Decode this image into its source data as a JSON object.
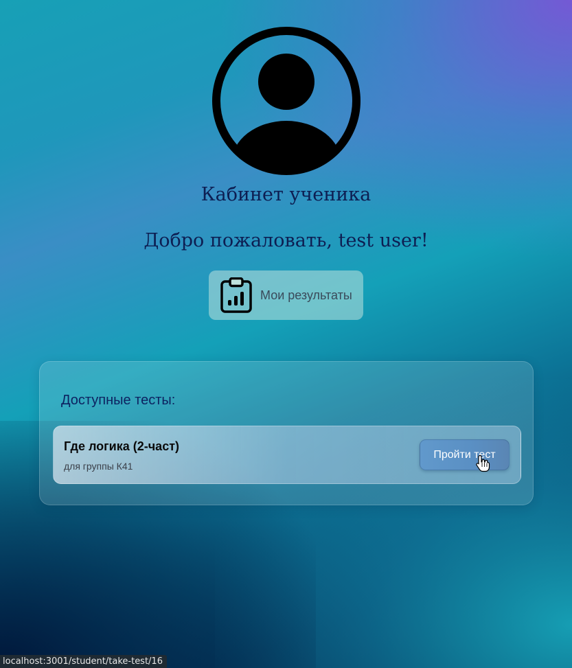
{
  "header": {
    "avatar_icon": "user-avatar-icon",
    "cabinet_title": "Кабинет ученика",
    "welcome": "Добро пожаловать, test user!"
  },
  "results_button": {
    "icon": "clipboard-chart-icon",
    "label": "Мои результаты"
  },
  "tests": {
    "title": "Доступные тесты:",
    "items": [
      {
        "name": "Где логика (2-част)",
        "group": "для группы К41",
        "button_label": "Пройти тест"
      }
    ]
  },
  "status_bar": {
    "url": "localhost:3001/student/take-test/16"
  },
  "colors": {
    "heading": "#0d1e52",
    "button": "#5a8fc3"
  }
}
